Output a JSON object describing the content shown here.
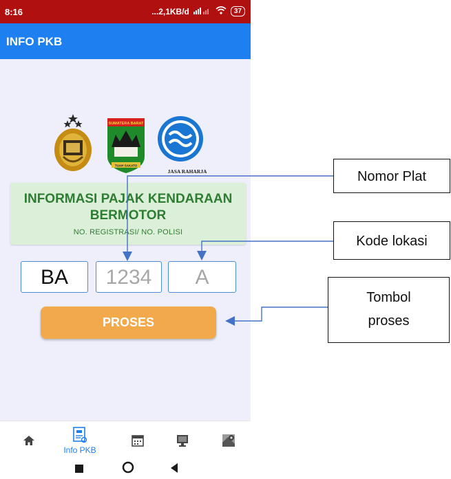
{
  "status_bar": {
    "time": "8:16",
    "network": "...2,1KB/d",
    "battery": "37"
  },
  "app_bar": {
    "title": "INFO PKB"
  },
  "logos": {
    "jasa_raharja": "JASA RAHARJA",
    "sumbar_top": "SUMATERA BARAT",
    "sumbar_bottom": "TUAH SAKATO"
  },
  "info_card": {
    "title": "INFORMASI PAJAK KENDARAAN BERMOTOR",
    "subtitle": "NO. REGISTRASI/ NO. POLISI"
  },
  "plate": {
    "region": "BA",
    "number_placeholder": "1234",
    "code_placeholder": "A"
  },
  "proses_button": "PROSES",
  "bottom_nav": {
    "active_label": "Info PKB",
    "items": [
      "home-icon",
      "info-pkb-icon",
      "calendar-icon",
      "monitor-icon",
      "map-icon"
    ]
  },
  "annotations": {
    "nomor_plat": "Nomor Plat",
    "kode_lokasi": "Kode lokasi",
    "tombol_proses_1": "Tombol",
    "tombol_proses_2": "proses"
  },
  "colors": {
    "status_bar": "#b01010",
    "app_bar": "#1e7ff0",
    "card": "#dcefd8",
    "button": "#f1a94b",
    "background": "#eeeffb"
  }
}
